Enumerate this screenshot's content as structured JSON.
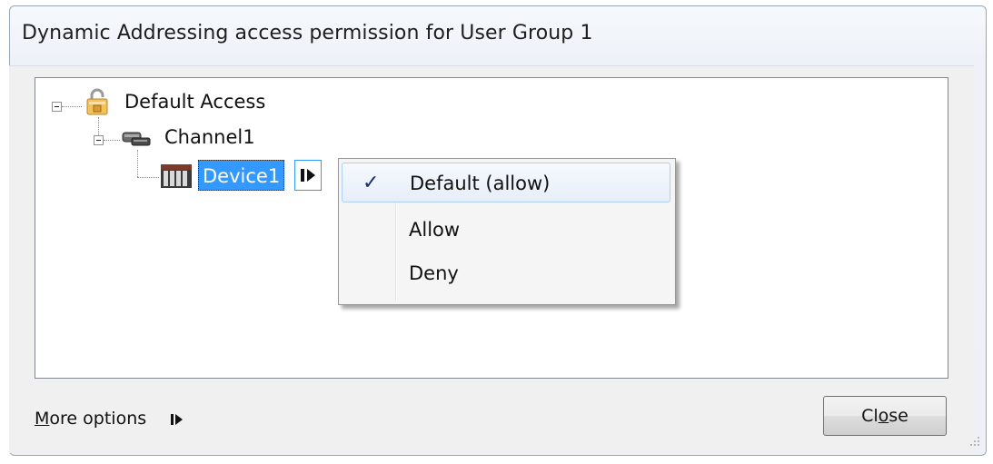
{
  "window": {
    "title": "Dynamic Addressing access permission for User Group 1"
  },
  "tree": {
    "root": {
      "label": "Default Access",
      "icon": "padlock-icon"
    },
    "channel": {
      "label": "Channel1",
      "icon": "channel-icon"
    },
    "device": {
      "label": "Device1",
      "icon": "device-icon"
    }
  },
  "context_menu": {
    "items": [
      {
        "label": "Default (allow)",
        "checked": true
      },
      {
        "label": "Allow",
        "checked": false
      },
      {
        "label": "Deny",
        "checked": false
      }
    ],
    "check_glyph": "✓"
  },
  "footer": {
    "more_options_prefix": "M",
    "more_options_rest": "ore options",
    "close_prefix": "Cl",
    "close_underlined": "o",
    "close_rest": "se"
  },
  "colors": {
    "selection": "#3399ff",
    "menu_highlight_border": "#aecff7"
  }
}
